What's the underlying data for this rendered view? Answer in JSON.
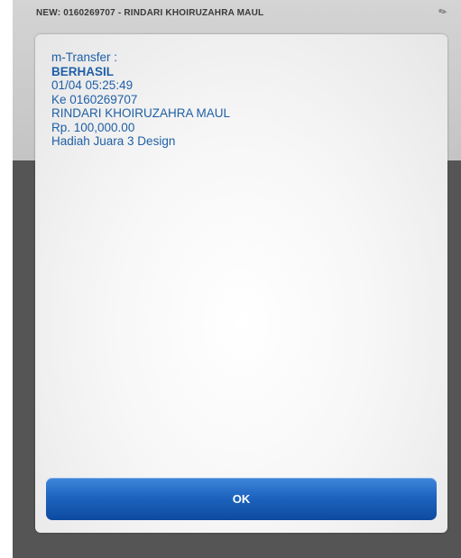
{
  "background": {
    "header_text": "NEW: 0160269707 - RINDARI KHOIRUZAHRA MAUL"
  },
  "dialog": {
    "lines": [
      "m-Transfer :",
      "BERHASIL",
      "01/04 05:25:49",
      "Ke 0160269707",
      "RINDARI KHOIRUZAHRA MAUL",
      "Rp. 100,000.00",
      "Hadiah Juara 3 Design"
    ],
    "ok_label": "OK"
  },
  "colors": {
    "message_text": "#1f5fa6",
    "button_top": "#3f86db",
    "button_bottom": "#0d4aa0",
    "overlay": "#555555"
  }
}
